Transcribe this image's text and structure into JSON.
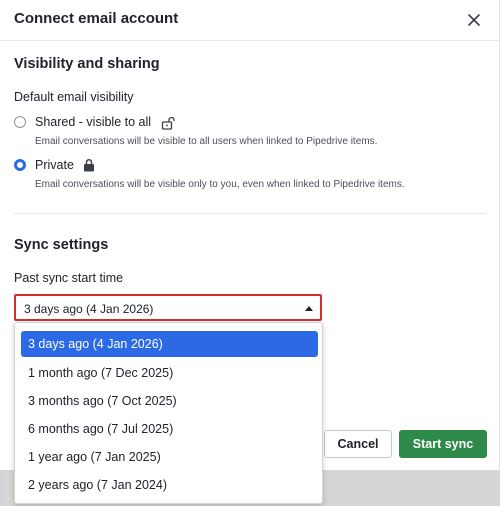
{
  "modal": {
    "title": "Connect email account",
    "close_icon": "close-icon"
  },
  "visibility": {
    "heading": "Visibility and sharing",
    "label": "Default email visibility",
    "options": [
      {
        "label": "Shared - visible to all",
        "help": "Email conversations will be visible to all users when linked to Pipedrive items.",
        "icon": "unlock-icon",
        "checked": false
      },
      {
        "label": "Private",
        "help": "Email conversations will be visible only to you, even when linked to Pipedrive items.",
        "icon": "lock-icon",
        "checked": true
      }
    ]
  },
  "sync": {
    "heading": "Sync settings",
    "label": "Past sync start time",
    "selected_value": "3 days ago (4 Jan 2026)",
    "options": [
      "3 days ago (4 Jan 2026)",
      "1 month ago (7 Dec 2025)",
      "3 months ago (7 Oct 2025)",
      "6 months ago (7 Jul 2025)",
      "1 year ago (7 Jan 2025)",
      "2 years ago (7 Jan 2024)"
    ]
  },
  "footer": {
    "cancel_label": "Cancel",
    "start_label": "Start sync"
  },
  "colors": {
    "accent": "#2c6ae5",
    "primary_button": "#2e8a48",
    "focus_border": "#d32f2f"
  }
}
